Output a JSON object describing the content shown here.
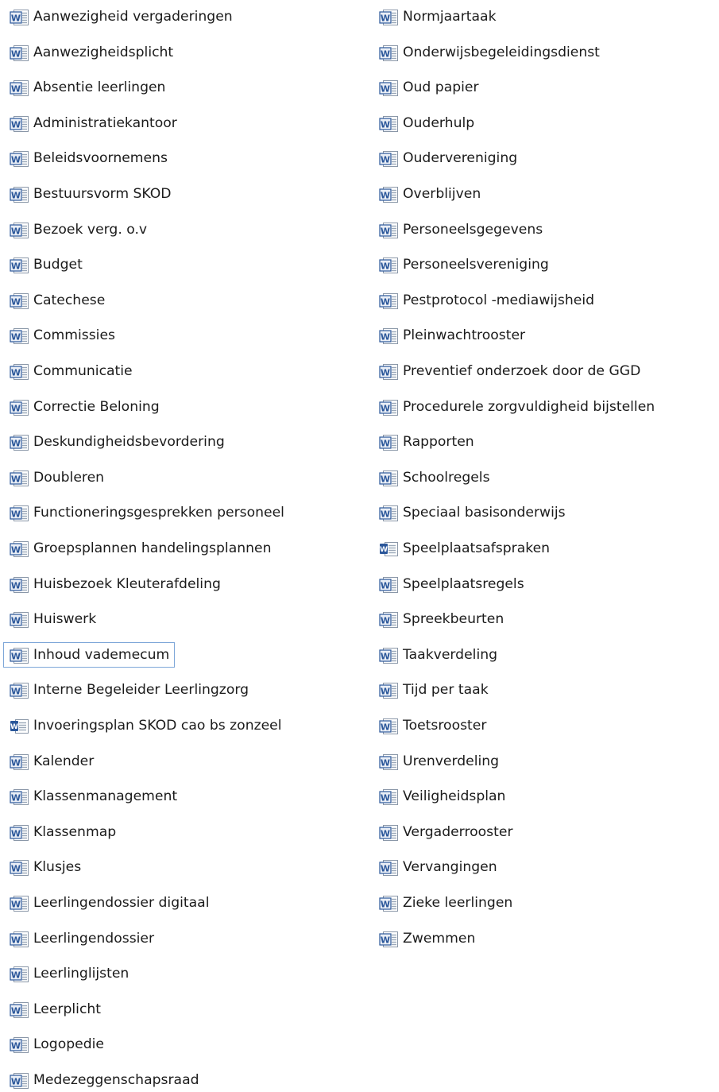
{
  "files": {
    "column_1": [
      {
        "name": "Aanwezigheid vergaderingen",
        "icon": "word-doc-icon"
      },
      {
        "name": "Aanwezigheidsplicht",
        "icon": "word-doc-icon"
      },
      {
        "name": "Absentie leerlingen",
        "icon": "word-doc-icon"
      },
      {
        "name": "Administratiekantoor",
        "icon": "word-doc-icon"
      },
      {
        "name": "Beleidsvoornemens",
        "icon": "word-doc-icon"
      },
      {
        "name": "Bestuursvorm SKOD",
        "icon": "word-doc-icon"
      },
      {
        "name": "Bezoek verg. o.v",
        "icon": "word-doc-icon"
      },
      {
        "name": "Budget",
        "icon": "word-doc-icon"
      },
      {
        "name": "Catechese",
        "icon": "word-doc-icon"
      },
      {
        "name": "Commissies",
        "icon": "word-doc-icon"
      },
      {
        "name": "Communicatie",
        "icon": "word-doc-icon"
      },
      {
        "name": "Correctie Beloning",
        "icon": "word-doc-icon"
      },
      {
        "name": "Deskundigheidsbevordering",
        "icon": "word-doc-icon"
      },
      {
        "name": "Doubleren",
        "icon": "word-doc-icon"
      },
      {
        "name": "Functioneringsgesprekken personeel",
        "icon": "word-doc-icon"
      },
      {
        "name": "Groepsplannen handelingsplannen",
        "icon": "word-doc-icon"
      },
      {
        "name": "Huisbezoek Kleuterafdeling",
        "icon": "word-doc-icon"
      },
      {
        "name": "Huiswerk",
        "icon": "word-doc-icon"
      },
      {
        "name": "Inhoud vademecum",
        "icon": "word-doc-icon",
        "selected": true
      },
      {
        "name": "Interne Begeleider Leerlingzorg",
        "icon": "word-doc-icon"
      },
      {
        "name": "Invoeringsplan SKOD cao bs zonzeel",
        "icon": "word-docx-icon"
      },
      {
        "name": "Kalender",
        "icon": "word-doc-icon"
      },
      {
        "name": "Klassenmanagement",
        "icon": "word-doc-icon"
      },
      {
        "name": "Klassenmap",
        "icon": "word-doc-icon"
      },
      {
        "name": "Klusjes",
        "icon": "word-doc-icon"
      },
      {
        "name": "Leerlingendossier digitaal",
        "icon": "word-doc-icon"
      },
      {
        "name": "Leerlingendossier",
        "icon": "word-doc-icon"
      },
      {
        "name": "Leerlinglijsten",
        "icon": "word-doc-icon"
      },
      {
        "name": "Leerplicht",
        "icon": "word-doc-icon"
      },
      {
        "name": "Logopedie",
        "icon": "word-doc-icon"
      },
      {
        "name": "Medezeggenschapsraad",
        "icon": "word-doc-icon"
      }
    ],
    "column_2": [
      {
        "name": "Normjaartaak",
        "icon": "word-doc-icon"
      },
      {
        "name": "Onderwijsbegeleidingsdienst",
        "icon": "word-doc-icon"
      },
      {
        "name": "Oud papier",
        "icon": "word-doc-icon"
      },
      {
        "name": "Ouderhulp",
        "icon": "word-doc-icon"
      },
      {
        "name": "Oudervereniging",
        "icon": "word-doc-icon"
      },
      {
        "name": "Overblijven",
        "icon": "word-doc-icon"
      },
      {
        "name": "Personeelsgegevens",
        "icon": "word-doc-icon"
      },
      {
        "name": "Personeelsvereniging",
        "icon": "word-doc-icon"
      },
      {
        "name": "Pestprotocol -mediawijsheid",
        "icon": "word-doc-icon"
      },
      {
        "name": "Pleinwachtrooster",
        "icon": "word-doc-icon"
      },
      {
        "name": "Preventief onderzoek door de GGD",
        "icon": "word-doc-icon"
      },
      {
        "name": "Procedurele zorgvuldigheid bijstellen",
        "icon": "word-doc-icon"
      },
      {
        "name": "Rapporten",
        "icon": "word-doc-icon"
      },
      {
        "name": "Schoolregels",
        "icon": "word-doc-icon"
      },
      {
        "name": "Speciaal basisonderwijs",
        "icon": "word-doc-icon"
      },
      {
        "name": "Speelplaatsafspraken",
        "icon": "word-docx-icon"
      },
      {
        "name": "Speelplaatsregels",
        "icon": "word-doc-icon"
      },
      {
        "name": "Spreekbeurten",
        "icon": "word-doc-icon"
      },
      {
        "name": "Taakverdeling",
        "icon": "word-doc-icon"
      },
      {
        "name": "Tijd per taak",
        "icon": "word-doc-icon"
      },
      {
        "name": "Toetsrooster",
        "icon": "word-doc-icon"
      },
      {
        "name": "Urenverdeling",
        "icon": "word-doc-icon"
      },
      {
        "name": "Veiligheidsplan",
        "icon": "word-doc-icon"
      },
      {
        "name": "Vergaderrooster",
        "icon": "word-doc-icon"
      },
      {
        "name": "Vervangingen",
        "icon": "word-doc-icon"
      },
      {
        "name": "Zieke leerlingen",
        "icon": "word-doc-icon"
      },
      {
        "name": "Zwemmen",
        "icon": "word-doc-icon"
      }
    ]
  },
  "colors": {
    "text": "#1b1b1b",
    "selection_border": "#7ea7d8",
    "icon_blue": "#2b579a",
    "icon_page": "#ffffff",
    "icon_lines": "#9aa7b8"
  }
}
